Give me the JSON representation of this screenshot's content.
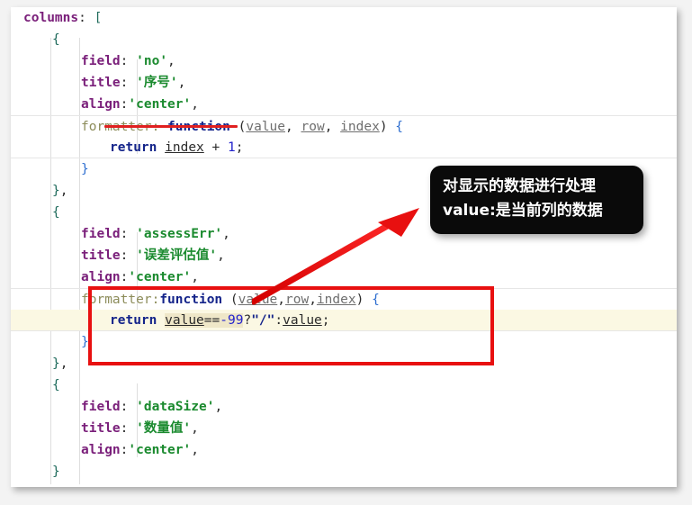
{
  "editor": {
    "language": "javascript",
    "font_size_px": 14.5
  },
  "code": {
    "lines": [
      {
        "indent": 0,
        "tokens": [
          {
            "t": "columns",
            "c": "key"
          },
          {
            "t": ": ",
            "c": "punct"
          },
          {
            "t": "[",
            "c": "brkt"
          }
        ]
      },
      {
        "indent": 1,
        "tokens": [
          {
            "t": "{",
            "c": "brace-o"
          }
        ]
      },
      {
        "indent": 2,
        "tokens": [
          {
            "t": "field",
            "c": "key"
          },
          {
            "t": ": ",
            "c": "punct"
          },
          {
            "t": "'no'",
            "c": "str"
          },
          {
            "t": ",",
            "c": "punct"
          }
        ]
      },
      {
        "indent": 2,
        "tokens": [
          {
            "t": "title",
            "c": "key"
          },
          {
            "t": ": ",
            "c": "punct"
          },
          {
            "t": "'序号'",
            "c": "str"
          },
          {
            "t": ",",
            "c": "punct"
          }
        ]
      },
      {
        "indent": 2,
        "tokens": [
          {
            "t": "align",
            "c": "key"
          },
          {
            "t": ":",
            "c": "punct"
          },
          {
            "t": "'center'",
            "c": "str"
          },
          {
            "t": ",",
            "c": "punct"
          }
        ]
      },
      {
        "indent": 2,
        "sep_top": true,
        "tokens": [
          {
            "t": "formatter",
            "c": "prop-mute"
          },
          {
            "t": ": ",
            "c": "prop-mute"
          },
          {
            "t": "function",
            "c": "kw"
          },
          {
            "t": " (",
            "c": "punct"
          },
          {
            "t": "value",
            "c": "param"
          },
          {
            "t": ", ",
            "c": "punct"
          },
          {
            "t": "row",
            "c": "param"
          },
          {
            "t": ", ",
            "c": "punct"
          },
          {
            "t": "index",
            "c": "param"
          },
          {
            "t": ") ",
            "c": "punct"
          },
          {
            "t": "{",
            "c": "brace-i"
          }
        ]
      },
      {
        "indent": 3,
        "sep_bot": true,
        "tokens": [
          {
            "t": "return",
            "c": "kw"
          },
          {
            "t": " ",
            "c": "punct"
          },
          {
            "t": "index",
            "c": "ident"
          },
          {
            "t": " + ",
            "c": "op"
          },
          {
            "t": "1",
            "c": "num"
          },
          {
            "t": ";",
            "c": "punct"
          }
        ]
      },
      {
        "indent": 2,
        "tokens": [
          {
            "t": "}",
            "c": "brace-i"
          }
        ]
      },
      {
        "indent": 1,
        "tokens": [
          {
            "t": "}",
            "c": "brace-o"
          },
          {
            "t": ",",
            "c": "punct"
          }
        ]
      },
      {
        "indent": 1,
        "tokens": [
          {
            "t": "{",
            "c": "brace-o"
          }
        ]
      },
      {
        "indent": 2,
        "tokens": [
          {
            "t": "field",
            "c": "key"
          },
          {
            "t": ": ",
            "c": "punct"
          },
          {
            "t": "'assessErr'",
            "c": "str"
          },
          {
            "t": ",",
            "c": "punct"
          }
        ]
      },
      {
        "indent": 2,
        "tokens": [
          {
            "t": "title",
            "c": "key"
          },
          {
            "t": ": ",
            "c": "punct"
          },
          {
            "t": "'误差评估值'",
            "c": "str"
          },
          {
            "t": ",",
            "c": "punct"
          }
        ]
      },
      {
        "indent": 2,
        "tokens": [
          {
            "t": "align",
            "c": "key"
          },
          {
            "t": ":",
            "c": "punct"
          },
          {
            "t": "'center'",
            "c": "str"
          },
          {
            "t": ",",
            "c": "punct"
          }
        ]
      },
      {
        "indent": 2,
        "sep_top": true,
        "tokens": [
          {
            "t": "formatter",
            "c": "prop-mute"
          },
          {
            "t": ":",
            "c": "prop-mute"
          },
          {
            "t": "function",
            "c": "kw"
          },
          {
            "t": " (",
            "c": "punct"
          },
          {
            "t": "value",
            "c": "param"
          },
          {
            "t": ",",
            "c": "punct"
          },
          {
            "t": "row",
            "c": "param"
          },
          {
            "t": ",",
            "c": "punct"
          },
          {
            "t": "index",
            "c": "param"
          },
          {
            "t": ") ",
            "c": "punct"
          },
          {
            "t": "{",
            "c": "brace-i"
          }
        ]
      },
      {
        "indent": 3,
        "highlight": true,
        "sep_bot": true,
        "tokens": [
          {
            "t": "return",
            "c": "kw"
          },
          {
            "t": " ",
            "c": "punct"
          },
          {
            "t": "value",
            "c": "ident tanhl"
          },
          {
            "t": "==",
            "c": "op tanhl"
          },
          {
            "t": "-99",
            "c": "num tanhl"
          },
          {
            "t": "?",
            "c": "punct"
          },
          {
            "t": "\"/\"",
            "c": "dstr"
          },
          {
            "t": ":",
            "c": "punct"
          },
          {
            "t": "value",
            "c": "ident"
          },
          {
            "t": ";",
            "c": "punct"
          }
        ]
      },
      {
        "indent": 2,
        "tokens": [
          {
            "t": "}",
            "c": "brace-i"
          }
        ]
      },
      {
        "indent": 1,
        "tokens": [
          {
            "t": "}",
            "c": "brace-o"
          },
          {
            "t": ",",
            "c": "punct"
          }
        ]
      },
      {
        "indent": 1,
        "tokens": [
          {
            "t": "{",
            "c": "brace-o"
          }
        ]
      },
      {
        "indent": 2,
        "tokens": [
          {
            "t": "field",
            "c": "key"
          },
          {
            "t": ": ",
            "c": "punct"
          },
          {
            "t": "'dataSize'",
            "c": "str"
          },
          {
            "t": ",",
            "c": "punct"
          }
        ]
      },
      {
        "indent": 2,
        "tokens": [
          {
            "t": "title",
            "c": "key"
          },
          {
            "t": ": ",
            "c": "punct"
          },
          {
            "t": "'数量值'",
            "c": "str"
          },
          {
            "t": ",",
            "c": "punct"
          }
        ]
      },
      {
        "indent": 2,
        "tokens": [
          {
            "t": "align",
            "c": "key"
          },
          {
            "t": ":",
            "c": "punct"
          },
          {
            "t": "'center'",
            "c": "str"
          },
          {
            "t": ",",
            "c": "punct"
          }
        ]
      },
      {
        "indent": 1,
        "tokens": [
          {
            "t": "}",
            "c": "brace-o"
          }
        ]
      },
      {
        "indent": 0,
        "tokens": [
          {
            "t": "]",
            "c": "brkt"
          }
        ]
      }
    ]
  },
  "annotations": {
    "tooltip": {
      "text": "对显示的数据进行处理\nvalue:是当前列的数据",
      "background_color": "#0a0a0a",
      "text_color": "#ffffff"
    },
    "arrow": {
      "color": "#e81010",
      "direction": "up-right",
      "points_to": "tooltip"
    },
    "highlight_box": {
      "color": "#e81010",
      "encloses": "formatter:function (value,row,index) { return value==-99?\"/\":value; }"
    },
    "underlines": [
      {
        "color": "#e02020",
        "under_line_text": "align:'center',"
      }
    ]
  }
}
